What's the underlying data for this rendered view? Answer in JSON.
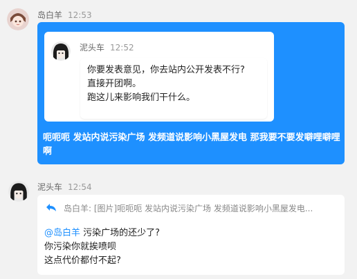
{
  "messages": [
    {
      "sender": "岛白羊",
      "time": "12:53",
      "quoted": {
        "sender": "泥头车",
        "time": "12:52",
        "lines": [
          "你要发表意见，你去站内公开发表不行?",
          "直接开团啊。",
          "跑这儿来影响我们干什么。"
        ]
      },
      "text": "呃呃呃 发站内说污染广场 发频道说影响小黑屋发电 那我要不要发噼哩噼哩啊"
    },
    {
      "sender": "泥头车",
      "time": "12:54",
      "reply_ref": "岛白羊: [图片]呃呃呃 发站内说污染广场 发频道说影响小黑屋发电...",
      "mention": "@岛白羊",
      "line1_rest": " 污染广场的还少了?",
      "line2": "你污染你就挨喷呗",
      "line3": "这点代价都付不起?"
    }
  ],
  "colors": {
    "accent": "#1e90ff",
    "background": "#f2f2f2"
  },
  "icons": {
    "reply": "reply-arrow-icon"
  }
}
